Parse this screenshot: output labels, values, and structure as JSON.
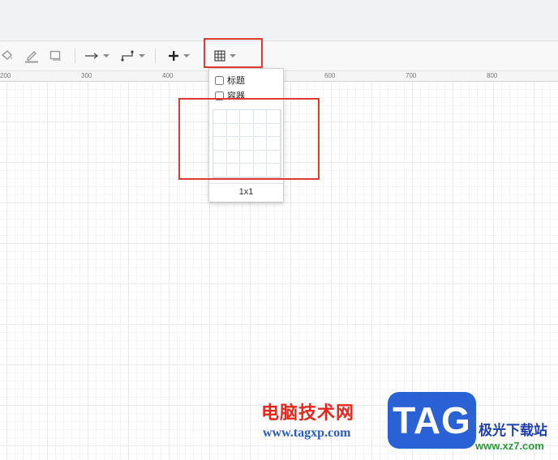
{
  "toolbar": {
    "table_label": "Table",
    "ruler": [
      "200",
      "300",
      "400",
      "500",
      "600",
      "700",
      "800"
    ]
  },
  "table_popup": {
    "options": [
      {
        "label": "标题"
      },
      {
        "label": "容器"
      }
    ],
    "size_label": "1x1"
  },
  "watermark": {
    "site_name": "电脑技术网",
    "site_url": "www.tagxp.com",
    "logo_text": "TAG",
    "right_text": "极光下载站",
    "right_url": "www.xz7.com"
  },
  "colors": {
    "highlight": "#e03a2f",
    "logo_bg": "#2a62d6"
  }
}
